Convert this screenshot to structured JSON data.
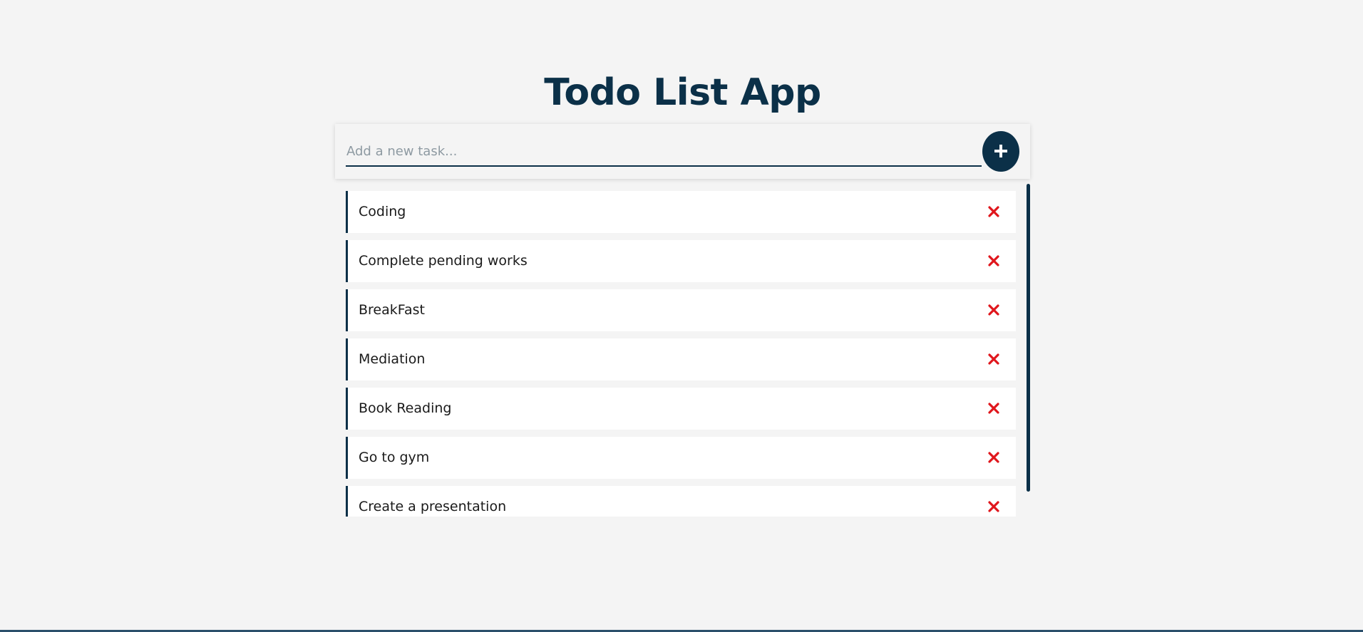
{
  "app": {
    "title": "Todo List App"
  },
  "input": {
    "placeholder": "Add a new task...",
    "value": ""
  },
  "add_button": {
    "icon": "plus-icon"
  },
  "tasks": [
    {
      "label": "Coding",
      "delete_icon": "close-icon"
    },
    {
      "label": "Complete pending works",
      "delete_icon": "close-icon"
    },
    {
      "label": "BreakFast",
      "delete_icon": "close-icon"
    },
    {
      "label": "Mediation",
      "delete_icon": "close-icon"
    },
    {
      "label": "Book Reading",
      "delete_icon": "close-icon"
    },
    {
      "label": "Go to gym",
      "delete_icon": "close-icon"
    },
    {
      "label": "Create a presentation",
      "delete_icon": "close-icon"
    }
  ],
  "colors": {
    "primary": "#0b3048",
    "background": "#f4f4f4",
    "delete": "#e0161c"
  }
}
